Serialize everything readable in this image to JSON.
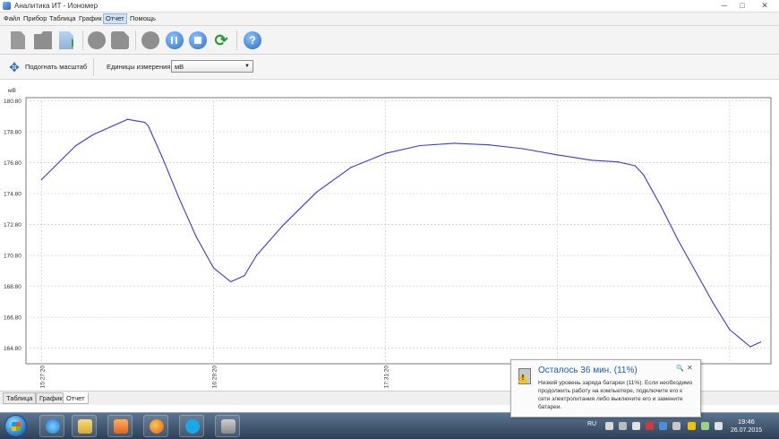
{
  "window": {
    "title": "Аналитика ИТ - Иономер",
    "min_glyph": "─",
    "max_glyph": "□",
    "close_glyph": "✕"
  },
  "menu": [
    {
      "label": "Файл"
    },
    {
      "label": "Прибор"
    },
    {
      "label": "Таблица"
    },
    {
      "label": "График"
    },
    {
      "label": "Отчет",
      "active": true
    },
    {
      "label": "Помощь"
    }
  ],
  "toolbar": {
    "icons": [
      "new-document-icon",
      "open-folder-icon",
      "export-icon",
      "record-icon",
      "save-icon",
      "stop-round-icon",
      "pause-icon",
      "stop-icon",
      "refresh-icon",
      "help-icon"
    ],
    "refresh_glyph": "⟳",
    "help_glyph": "?"
  },
  "subbar": {
    "fit_icon": "move-arrows-icon",
    "fit_glyph": "✥",
    "fit_label": "Подогнать масштаб",
    "units_label": "Единицы измерения:",
    "units_value": "мВ",
    "units_arrow": "▼"
  },
  "chart_data": {
    "type": "line",
    "ylabel": "мВ",
    "ylim": [
      163.8,
      181.0
    ],
    "yticks": [
      164.8,
      166.8,
      168.8,
      170.8,
      172.8,
      174.8,
      176.8,
      178.8,
      180.8
    ],
    "ytick_labels": [
      "164.80",
      "166.80",
      "168.80",
      "170.80",
      "172.80",
      "174.80",
      "176.80",
      "178.80",
      "180.80"
    ],
    "x_range": [
      -0.09,
      4.24
    ],
    "xticks": [
      0,
      1,
      2,
      3,
      4
    ],
    "xtick_labels": [
      "15:27:20",
      "16:29:20",
      "17:31:20",
      "",
      ""
    ],
    "series": [
      {
        "color": "#3a3ad6",
        "x": [
          0.0,
          0.1,
          0.2,
          0.3,
          0.4,
          0.5,
          0.6,
          0.62,
          0.7,
          0.8,
          0.9,
          1.0,
          1.1,
          1.18,
          1.25,
          1.4,
          1.6,
          1.8,
          2.0,
          2.2,
          2.4,
          2.6,
          2.8,
          3.0,
          3.2,
          3.35,
          3.45,
          3.5,
          3.6,
          3.7,
          3.8,
          3.9,
          4.0,
          4.12,
          4.18
        ],
        "y": [
          175.7,
          176.8,
          177.9,
          178.6,
          179.1,
          179.6,
          179.4,
          179.2,
          177.2,
          174.5,
          172.0,
          170.0,
          169.1,
          169.5,
          170.8,
          172.7,
          174.9,
          176.5,
          177.4,
          177.9,
          178.05,
          177.95,
          177.7,
          177.3,
          176.95,
          176.85,
          176.6,
          176.0,
          174.0,
          171.8,
          169.8,
          167.8,
          166.0,
          164.9,
          165.2
        ]
      }
    ],
    "grid": true
  },
  "tabs": [
    {
      "label": "Таблица"
    },
    {
      "label": "График"
    },
    {
      "label": "Отчет",
      "active": true
    }
  ],
  "notification": {
    "title": "Осталось 36 мин. (11%)",
    "body": "Низкий уровень заряда батареи (11%). Если необходимо продолжить работу на компьютере, подключите его к сети электропитания либо выключите его и замените батареи.",
    "pin_glyph": "🔍",
    "close_glyph": "✕"
  },
  "taskbar": {
    "apps": [
      "internet-explorer-icon",
      "file-explorer-icon",
      "media-player-icon",
      "firefox-icon",
      "skype-icon",
      "analytics-app-icon"
    ],
    "language": "RU",
    "time": "19:46",
    "date": "26.07.2015"
  }
}
